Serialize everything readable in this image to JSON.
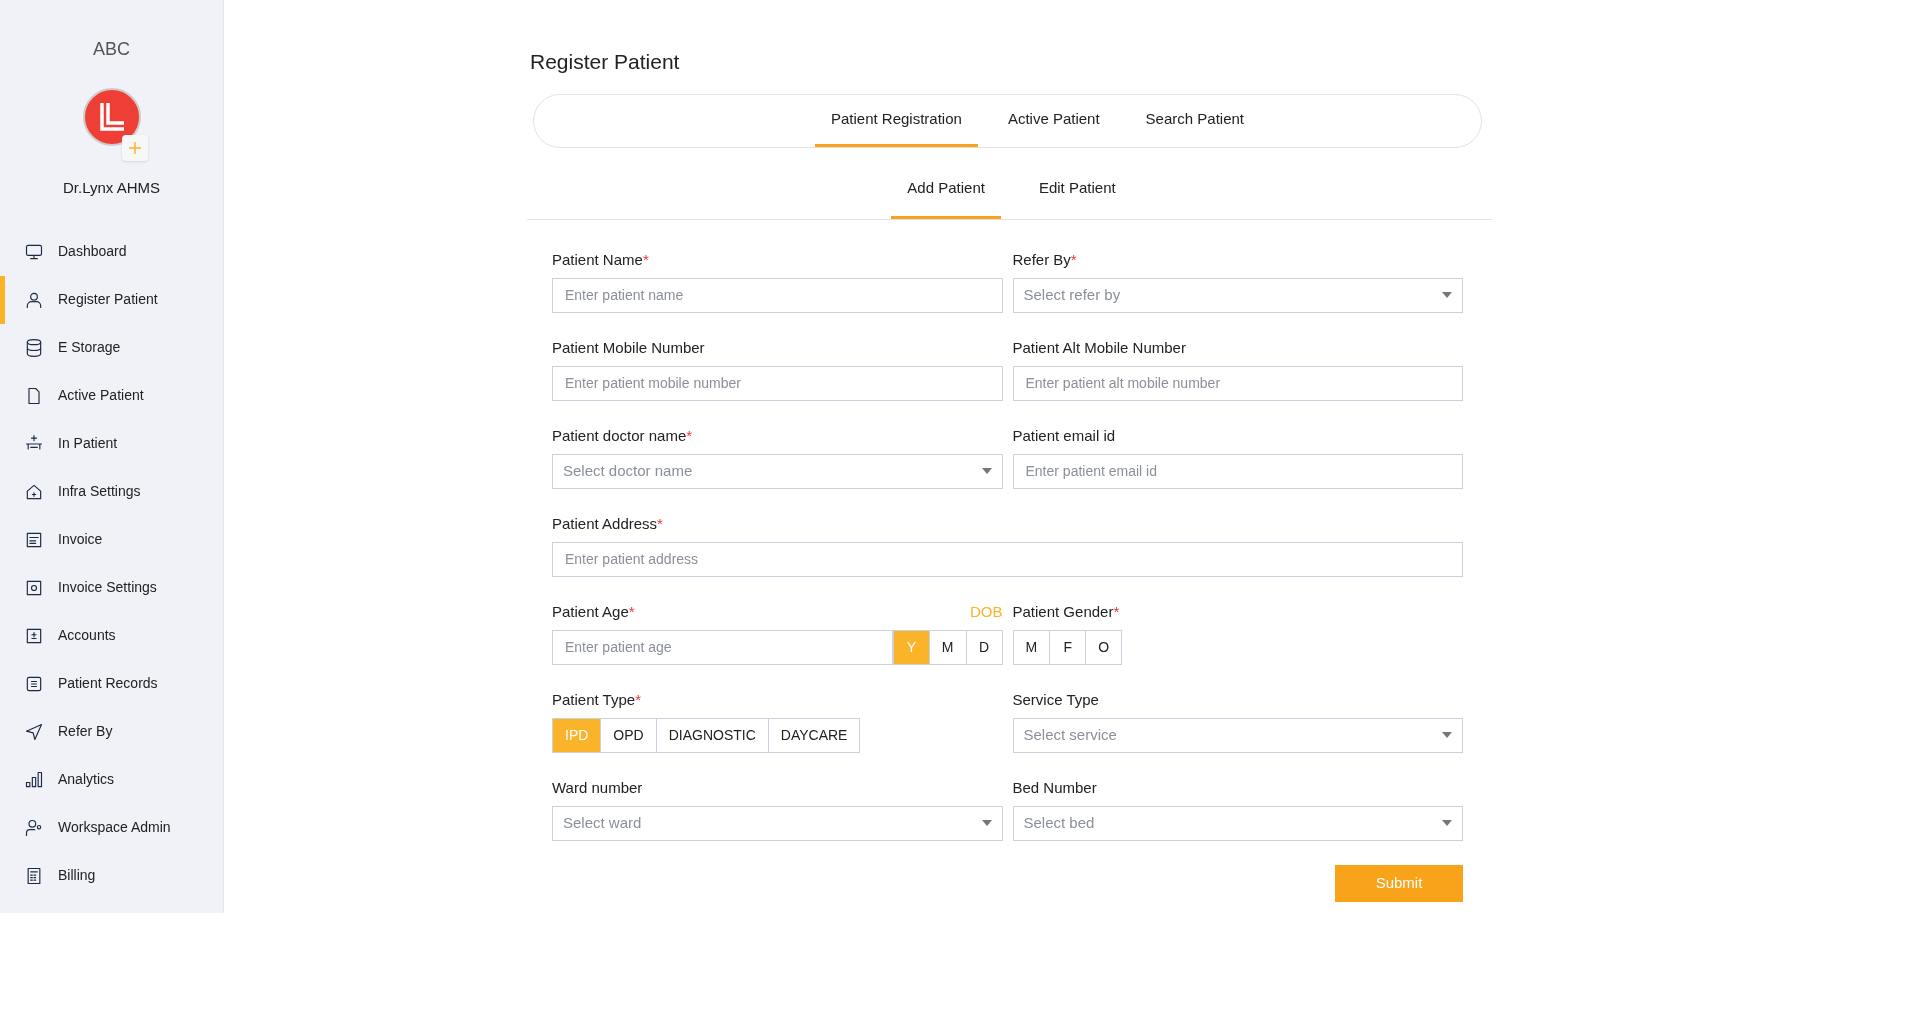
{
  "sidebar": {
    "brand": "ABC",
    "org": "Dr.Lynx AHMS",
    "items": [
      {
        "label": "Dashboard",
        "selected": false
      },
      {
        "label": "Register Patient",
        "selected": true
      },
      {
        "label": "E Storage",
        "selected": false
      },
      {
        "label": "Active Patient",
        "selected": false
      },
      {
        "label": "In Patient",
        "selected": false
      },
      {
        "label": "Infra Settings",
        "selected": false
      },
      {
        "label": "Invoice",
        "selected": false
      },
      {
        "label": "Invoice Settings",
        "selected": false
      },
      {
        "label": "Accounts",
        "selected": false
      },
      {
        "label": "Patient Records",
        "selected": false
      },
      {
        "label": "Refer By",
        "selected": false
      },
      {
        "label": "Analytics",
        "selected": false
      },
      {
        "label": "Workspace Admin",
        "selected": false
      },
      {
        "label": "Billing",
        "selected": false
      }
    ]
  },
  "page_title": "Register Patient",
  "tabs": [
    {
      "label": "Patient Registration",
      "selected": true
    },
    {
      "label": "Active Patient",
      "selected": false
    },
    {
      "label": "Search Patient",
      "selected": false
    }
  ],
  "subtabs": [
    {
      "label": "Add Patient",
      "selected": true
    },
    {
      "label": "Edit Patient",
      "selected": false
    }
  ],
  "fields": [
    {
      "kind": "text",
      "label": "Patient Name",
      "required_mark": "*",
      "placeholder": "Enter patient name"
    },
    {
      "kind": "select",
      "label": "Refer By",
      "required_mark": "*",
      "placeholder": "Select refer by"
    },
    {
      "kind": "text",
      "label": "Patient Mobile Number",
      "placeholder": "Enter patient mobile number"
    },
    {
      "kind": "text",
      "label": "Patient Alt Mobile Number",
      "placeholder": "Enter patient alt mobile number"
    },
    {
      "kind": "select",
      "label": "Patient doctor name",
      "required_mark": "*",
      "placeholder": "Select doctor name"
    },
    {
      "kind": "text",
      "label": "Patient email id",
      "placeholder": "Enter patient email id"
    },
    {
      "kind": "wide",
      "label": "Patient Address",
      "required_mark": "*",
      "placeholder": "Enter patient address"
    },
    {
      "kind": "age",
      "label": "Patient Age",
      "required_mark": "*",
      "placeholder": "Enter patient age",
      "link": "DOB",
      "options": [
        {
          "label": "Y",
          "selected": true
        },
        {
          "label": "M",
          "selected": false
        },
        {
          "label": "D",
          "selected": false
        }
      ]
    },
    {
      "kind": "segmented",
      "label": "Patient Gender",
      "required_mark": "*",
      "options": [
        {
          "label": "M",
          "selected": false
        },
        {
          "label": "F",
          "selected": false
        },
        {
          "label": "O",
          "selected": false
        }
      ]
    },
    {
      "kind": "segmented",
      "label": "Patient Type",
      "required_mark": "*",
      "options": [
        {
          "label": "IPD",
          "selected": true
        },
        {
          "label": "OPD",
          "selected": false
        },
        {
          "label": "DIAGNOSTIC",
          "selected": false
        },
        {
          "label": "DAYCARE",
          "selected": false
        }
      ]
    },
    {
      "kind": "select",
      "label": "Service Type",
      "placeholder": "Select service"
    },
    {
      "kind": "select",
      "label": "Ward number",
      "placeholder": "Select ward"
    },
    {
      "kind": "select",
      "label": "Bed Number",
      "placeholder": "Select bed"
    }
  ],
  "submit": "Submit"
}
